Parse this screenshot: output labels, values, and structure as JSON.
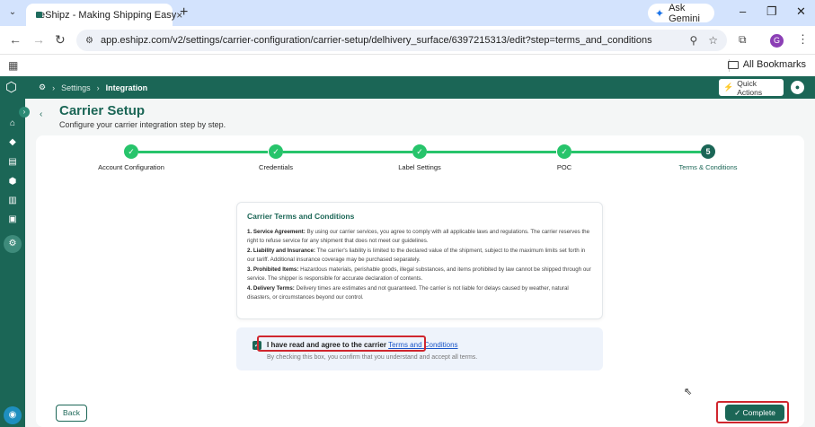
{
  "browser": {
    "tab_title": "eShipz - Making Shipping Easy",
    "new_tab": "+",
    "gemini": "Ask Gemini",
    "url": "app.eshipz.com/v2/settings/carrier-configuration/carrier-setup/delhivery_surface/6397215313/edit?step=terms_and_conditions",
    "profile_initial": "G",
    "bookmarks_label": "All Bookmarks"
  },
  "app": {
    "breadcrumb": [
      "Settings",
      "Integration"
    ],
    "quick_actions": "Quick Actions",
    "page_title": "Carrier Setup",
    "page_subtitle": "Configure your carrier integration step by step."
  },
  "stepper": {
    "steps": [
      {
        "label": "Account Configuration",
        "done": true
      },
      {
        "label": "Credentials",
        "done": true
      },
      {
        "label": "Label Settings",
        "done": true
      },
      {
        "label": "POC",
        "done": true
      },
      {
        "label": "Terms & Conditions",
        "done": false,
        "number": "5"
      }
    ],
    "done_color": "#27c46b",
    "current_color": "#1b6656"
  },
  "terms": {
    "heading": "Carrier Terms and Conditions",
    "items": [
      {
        "title": "1. Service Agreement:",
        "text": " By using our carrier services, you agree to comply with all applicable laws and regulations. The carrier reserves the right to refuse service for any shipment that does not meet our guidelines."
      },
      {
        "title": "2. Liability and Insurance:",
        "text": " The carrier's liability is limited to the declared value of the shipment, subject to the maximum limits set forth in our tariff. Additional insurance coverage may be purchased separately."
      },
      {
        "title": "3. Prohibited Items:",
        "text": " Hazardous materials, perishable goods, illegal substances, and items prohibited by law cannot be shipped through our service. The shipper is responsible for accurate declaration of contents."
      },
      {
        "title": "4. Delivery Terms:",
        "text": " Delivery times are estimates and not guaranteed. The carrier is not liable for delays caused by weather, natural disasters, or circumstances beyond our control."
      }
    ]
  },
  "agreement": {
    "checked": true,
    "label": "I have read and agree to the carrier ",
    "link": "Terms and Conditions",
    "note": "By checking this box, you confirm that you understand and accept all terms."
  },
  "footer": {
    "back": "Back",
    "complete": "Complete"
  },
  "colors": {
    "brand": "#1b6656",
    "highlight": "#d0262e"
  }
}
